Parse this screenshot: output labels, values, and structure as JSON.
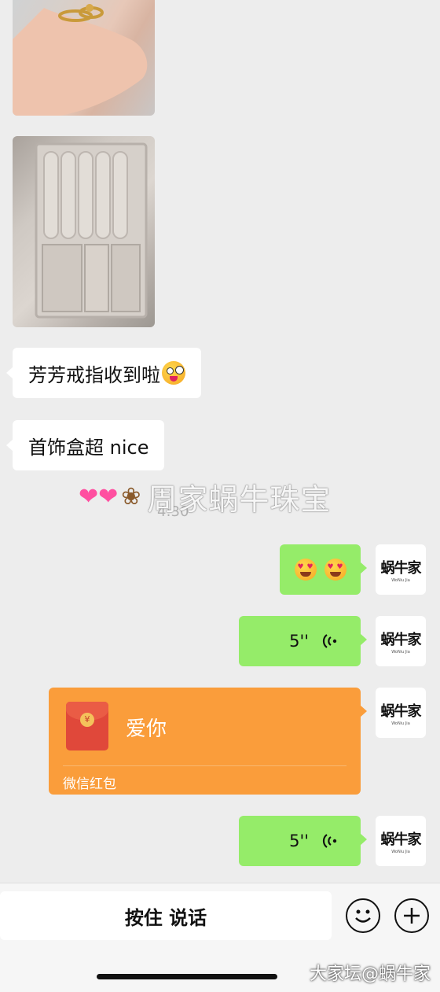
{
  "messages_in": [
    {
      "text": "芳芳戒指收到啦",
      "emoji": "zany-face-emoji"
    },
    {
      "text": "首饰盒超 nice"
    }
  ],
  "overlay": {
    "title": "周家蜗牛珠宝",
    "time": "4:30"
  },
  "avatar": {
    "logo": "蜗牛家",
    "logo_sub": "WoNiu Jia"
  },
  "voice_messages": [
    {
      "duration": "5''"
    },
    {
      "duration": "5''"
    }
  ],
  "red_packet": {
    "title": "爱你",
    "subtitle": "微信红包",
    "icon_symbol": "¥"
  },
  "input_bar": {
    "hold_to_talk": "按住 说话"
  },
  "watermark": "大家坛@蜗牛家",
  "colors": {
    "outgoing": "#95ec69",
    "red_packet": "#fa9d3b",
    "background": "#ededed"
  }
}
